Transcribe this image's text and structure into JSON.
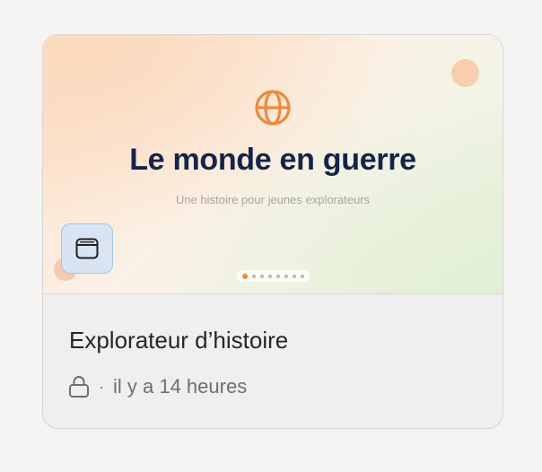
{
  "preview": {
    "title": "Le monde en guerre",
    "subtitle": "Une histoire pour jeunes explorateurs",
    "icon": "globe-icon",
    "app_icon": "window-icon",
    "pager": {
      "count": 8,
      "active": 0
    }
  },
  "card": {
    "title": "Explorateur d’histoire",
    "visibility_icon": "lock-icon",
    "separator": "·",
    "timestamp": "il y a 14 heures"
  },
  "colors": {
    "title": "#14244a",
    "accent": "#f2883a",
    "app_button_bg": "#d9e4f3",
    "app_button_border": "#a5c5e6"
  }
}
